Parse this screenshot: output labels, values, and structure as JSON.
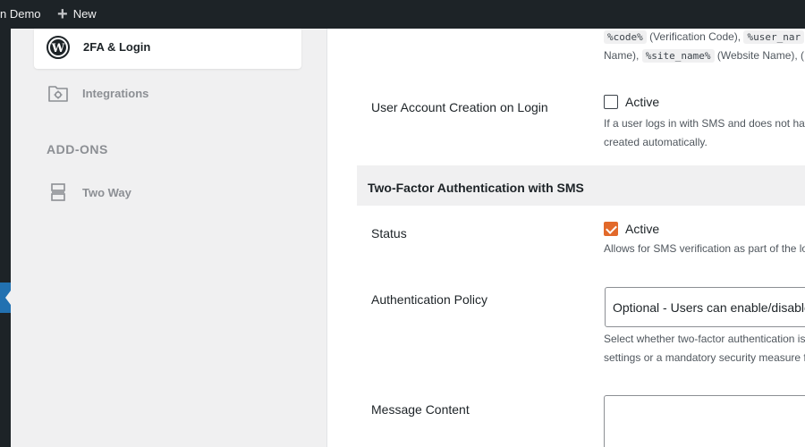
{
  "admin_bar": {
    "site_name": "n Demo",
    "new_label": "New"
  },
  "sidebar": {
    "active_item": {
      "label": "2FA & Login",
      "icon": "wordpress-icon"
    },
    "items": [
      {
        "label": "Integrations",
        "icon": "folder-gear-icon"
      }
    ],
    "addons_heading": "ADD-ONS",
    "addons": [
      {
        "label": "Two Way",
        "icon": "two-way-icon"
      }
    ]
  },
  "main": {
    "placeholders_line1": {
      "code_tag": "%code%",
      "code_desc": "(Verification Code),",
      "user_tag": "%user_nar"
    },
    "placeholders_line2": {
      "name_prefix": "Name),",
      "site_tag": "%site_name%",
      "site_desc": "(Website Name), ("
    },
    "user_account_creation": {
      "label": "User Account Creation on Login",
      "checkbox_label": "Active",
      "checked": false,
      "desc_line1": "If a user logs in with SMS and does not hav",
      "desc_line2": "created automatically."
    },
    "section_title": "Two-Factor Authentication with SMS",
    "status": {
      "label": "Status",
      "checkbox_label": "Active",
      "checked": true,
      "desc": "Allows for SMS verification as part of the lo"
    },
    "auth_policy": {
      "label": "Authentication Policy",
      "selected": "Optional - Users can enable/disable",
      "desc_line1": "Select whether two-factor authentication is",
      "desc_line2": "settings or a mandatory security measure fo"
    },
    "message_content": {
      "label": "Message Content",
      "value": ""
    }
  },
  "colors": {
    "accent": "#e2692a",
    "admin_bar": "#1d2327",
    "current_menu": "#2271b1"
  }
}
